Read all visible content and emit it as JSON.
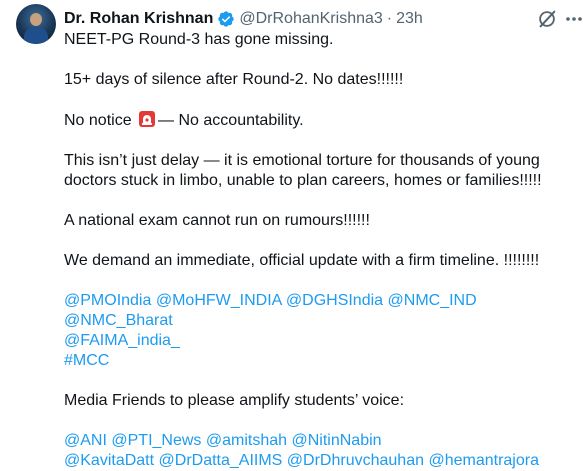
{
  "post": {
    "author_name": "Dr. Rohan Krishnan",
    "handle": "@DrRohanKrishna3",
    "separator": "·",
    "time": "23h",
    "line1": "NEET-PG Round-3 has gone missing.",
    "line2": "15+ days of silence after Round-2. No dates!!!!!!",
    "line3_before": "No notice ",
    "line3_after": "— No accountability.",
    "line4a": "This isn’t just delay — it is emotional torture for thousands of young",
    "line4b": "doctors stuck in limbo, unable to plan careers, homes or families!!!!!",
    "line5": "A national exam cannot run on rumours!!!!!!",
    "line6": "We demand an immediate, official update with a firm timeline. !!!!!!!!",
    "mentions1": [
      "@PMOIndia",
      "@MoHFW_INDIA",
      "@DGHSIndia",
      "@NMC_IND",
      "@NMC_Bharat"
    ],
    "mentions2": [
      "@FAIMA_india_"
    ],
    "hashtag": "#MCC",
    "line7": "Media Friends to please amplify students’ voice:",
    "mentions3": [
      "@ANI",
      "@PTI_News",
      "@amitshah",
      "@NitinNabin"
    ],
    "mentions4": [
      "@KavitaDatt",
      "@DrDatta_AIIMS",
      "@DrDhruvchauhan",
      "@hemantrajora"
    ]
  },
  "icons": {
    "verified": "verified-badge-icon",
    "grok": "grok-icon",
    "more": "more-options-icon",
    "siren": "siren-emoji-icon"
  },
  "colors": {
    "link": "#1d9bf0",
    "secondary_text": "#536471",
    "primary_text": "#0f1419"
  }
}
